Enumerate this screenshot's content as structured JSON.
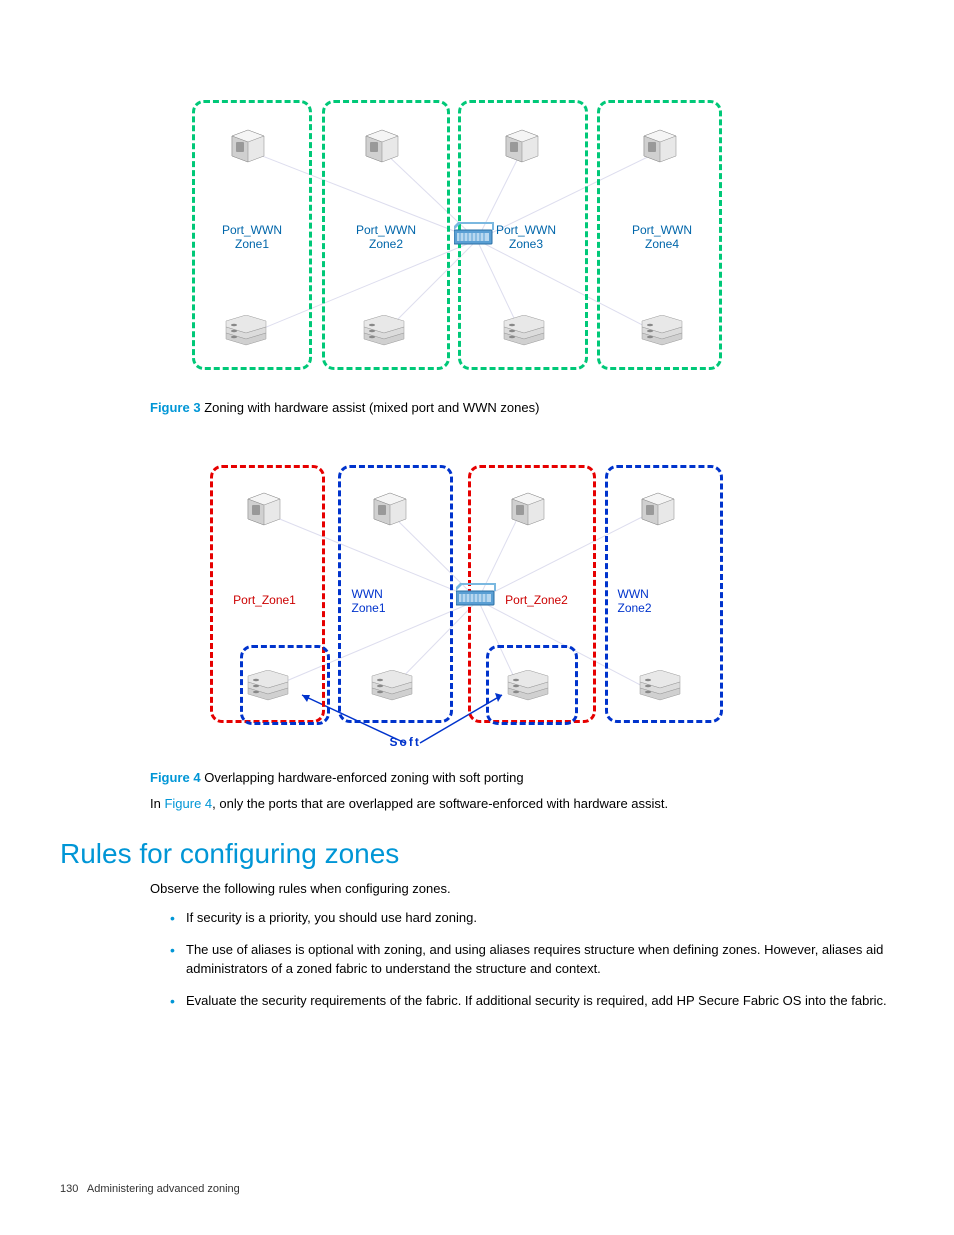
{
  "figure3": {
    "label": "Figure 3",
    "caption": "Zoning with hardware assist (mixed port and WWN zones)",
    "zones": [
      {
        "text": "Port_WWN\nZone1",
        "color": "#00c878"
      },
      {
        "text": "Port_WWN\nZone2",
        "color": "#00c878"
      },
      {
        "text": "Port_WWN\nZone3",
        "color": "#00c878"
      },
      {
        "text": "Port_WWN\nZone4",
        "color": "#00c878"
      }
    ]
  },
  "figure4": {
    "label": "Figure 4",
    "caption": "Overlapping hardware-enforced zoning with soft porting",
    "zones": [
      {
        "text": "Port_Zone1",
        "color": "#e60000"
      },
      {
        "text": "WWN\nZone1",
        "color": "#0033cc"
      },
      {
        "text": "Port_Zone2",
        "color": "#e60000"
      },
      {
        "text": "WWN\nZone2",
        "color": "#0033cc"
      }
    ],
    "soft_label": "Soft"
  },
  "body_after_fig4": {
    "prefix": "In ",
    "link": "Figure 4",
    "suffix": ", only the ports that are overlapped are software-enforced with hardware assist."
  },
  "section_heading": "Rules for configuring zones",
  "section_intro": "Observe the following rules when configuring zones.",
  "rules": [
    "If security is a priority, you should use hard zoning.",
    "The use of aliases is optional with zoning, and using aliases requires structure when defining zones. However, aliases aid administrators of a zoned fabric to understand the structure and context.",
    "Evaluate the security requirements of the fabric. If additional security is required, add HP Secure Fabric OS into the fabric."
  ],
  "footer": {
    "page": "130",
    "title": "Administering advanced zoning"
  }
}
